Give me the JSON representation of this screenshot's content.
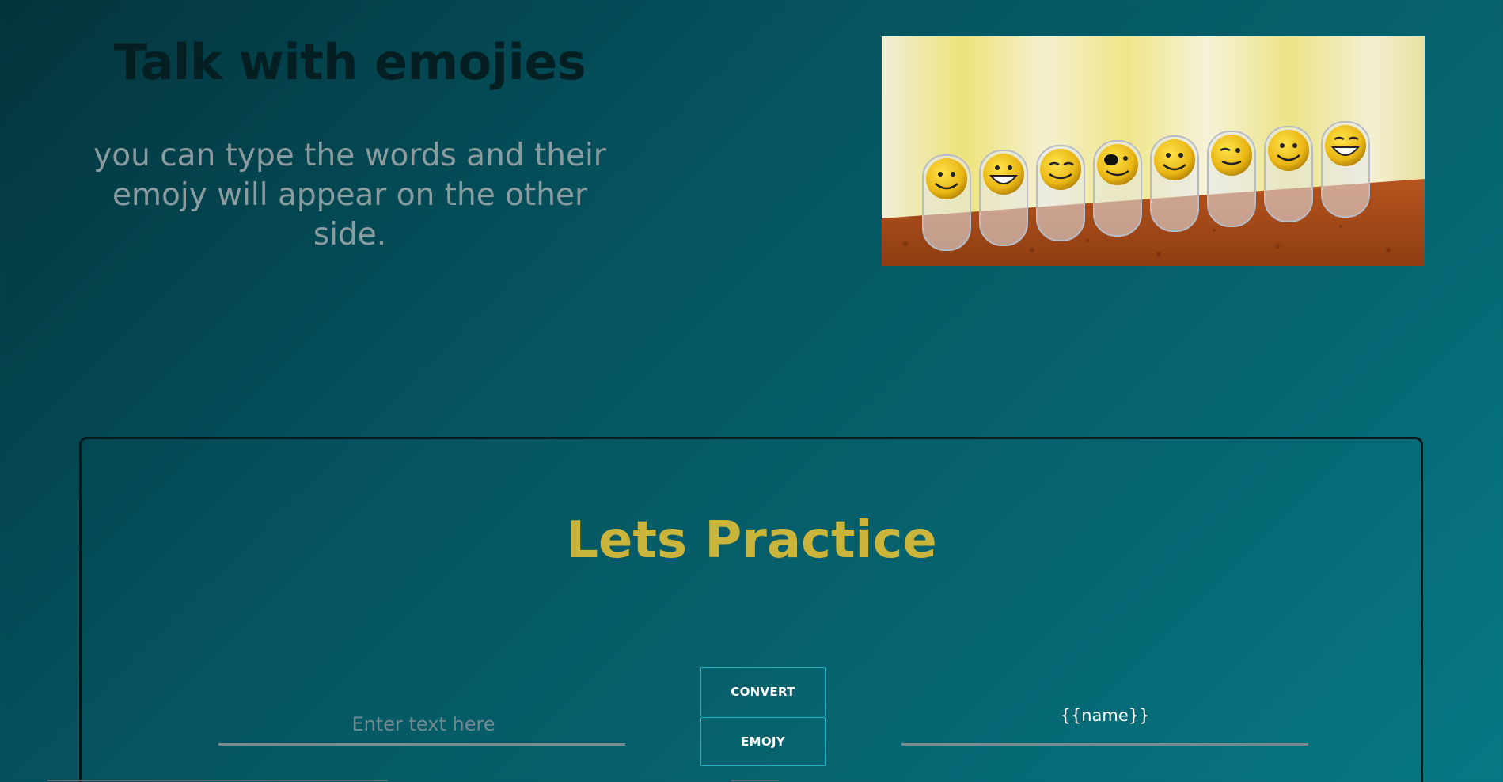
{
  "hero": {
    "title": "Talk with emojies",
    "subtitle": "you can type the words and their emojy will appear on the other side.",
    "image_alt": "row of smiley face clips on cork board"
  },
  "practice": {
    "title": "Lets Practice",
    "input_placeholder": "Enter text here",
    "input_value": "",
    "convert_button": "CONVERT",
    "emojy_button": "EMOJY",
    "output_text": "{{name}}"
  },
  "colors": {
    "background_start": "#03343d",
    "background_end": "#077883",
    "title": "#041e22",
    "subtitle": "#8a9ca0",
    "practice_title": "#c9b53c",
    "button_border": "#1fb4c2"
  },
  "icons": {
    "hero_image": "smiley-clips-photo"
  }
}
